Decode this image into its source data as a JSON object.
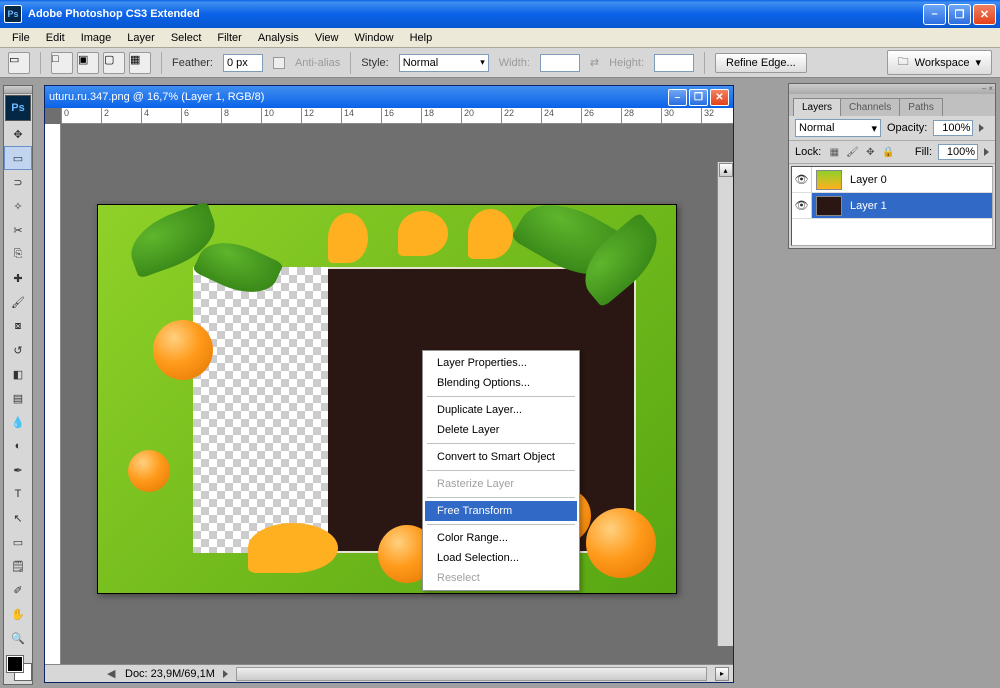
{
  "app": {
    "title": "Adobe Photoshop CS3 Extended"
  },
  "menu": [
    "File",
    "Edit",
    "Image",
    "Layer",
    "Select",
    "Filter",
    "Analysis",
    "View",
    "Window",
    "Help"
  ],
  "options": {
    "feather_label": "Feather:",
    "feather_value": "0 px",
    "antialias_label": "Anti-alias",
    "style_label": "Style:",
    "style_value": "Normal",
    "width_label": "Width:",
    "height_label": "Height:",
    "refine_btn": "Refine Edge...",
    "workspace_btn": "Workspace"
  },
  "document": {
    "title": "uturu.ru.347.png @ 16,7% (Layer 1, RGB/8)",
    "ruler_ticks": [
      "0",
      "2",
      "4",
      "6",
      "8",
      "10",
      "12",
      "14",
      "16",
      "18",
      "20",
      "22",
      "24",
      "26",
      "28",
      "30",
      "32"
    ],
    "doc_size": "Doc: 23,9M/69,1M"
  },
  "context_menu": [
    {
      "label": "Layer Properties...",
      "enabled": true
    },
    {
      "label": "Blending Options...",
      "enabled": true
    },
    {
      "sep": true
    },
    {
      "label": "Duplicate Layer...",
      "enabled": true
    },
    {
      "label": "Delete Layer",
      "enabled": true
    },
    {
      "sep": true
    },
    {
      "label": "Convert to Smart Object",
      "enabled": true
    },
    {
      "sep": true
    },
    {
      "label": "Rasterize Layer",
      "enabled": false
    },
    {
      "sep": true
    },
    {
      "label": "Free Transform",
      "enabled": true,
      "selected": true
    },
    {
      "sep": true
    },
    {
      "label": "Color Range...",
      "enabled": true
    },
    {
      "label": "Load Selection...",
      "enabled": true
    },
    {
      "label": "Reselect",
      "enabled": false
    }
  ],
  "layers_panel": {
    "tabs": [
      "Layers",
      "Channels",
      "Paths"
    ],
    "blend_mode": "Normal",
    "opacity_label": "Opacity:",
    "opacity_value": "100%",
    "lock_label": "Lock:",
    "fill_label": "Fill:",
    "fill_value": "100%",
    "layers": [
      {
        "name": "Layer 0",
        "selected": false
      },
      {
        "name": "Layer 1",
        "selected": true
      }
    ]
  },
  "tools": [
    "move",
    "marquee",
    "lasso",
    "wand",
    "crop",
    "slice",
    "heal",
    "brush",
    "stamp",
    "history",
    "eraser",
    "gradient",
    "blur",
    "dodge",
    "pen",
    "type",
    "path",
    "shape",
    "notes",
    "eyedrop",
    "hand",
    "zoom"
  ]
}
